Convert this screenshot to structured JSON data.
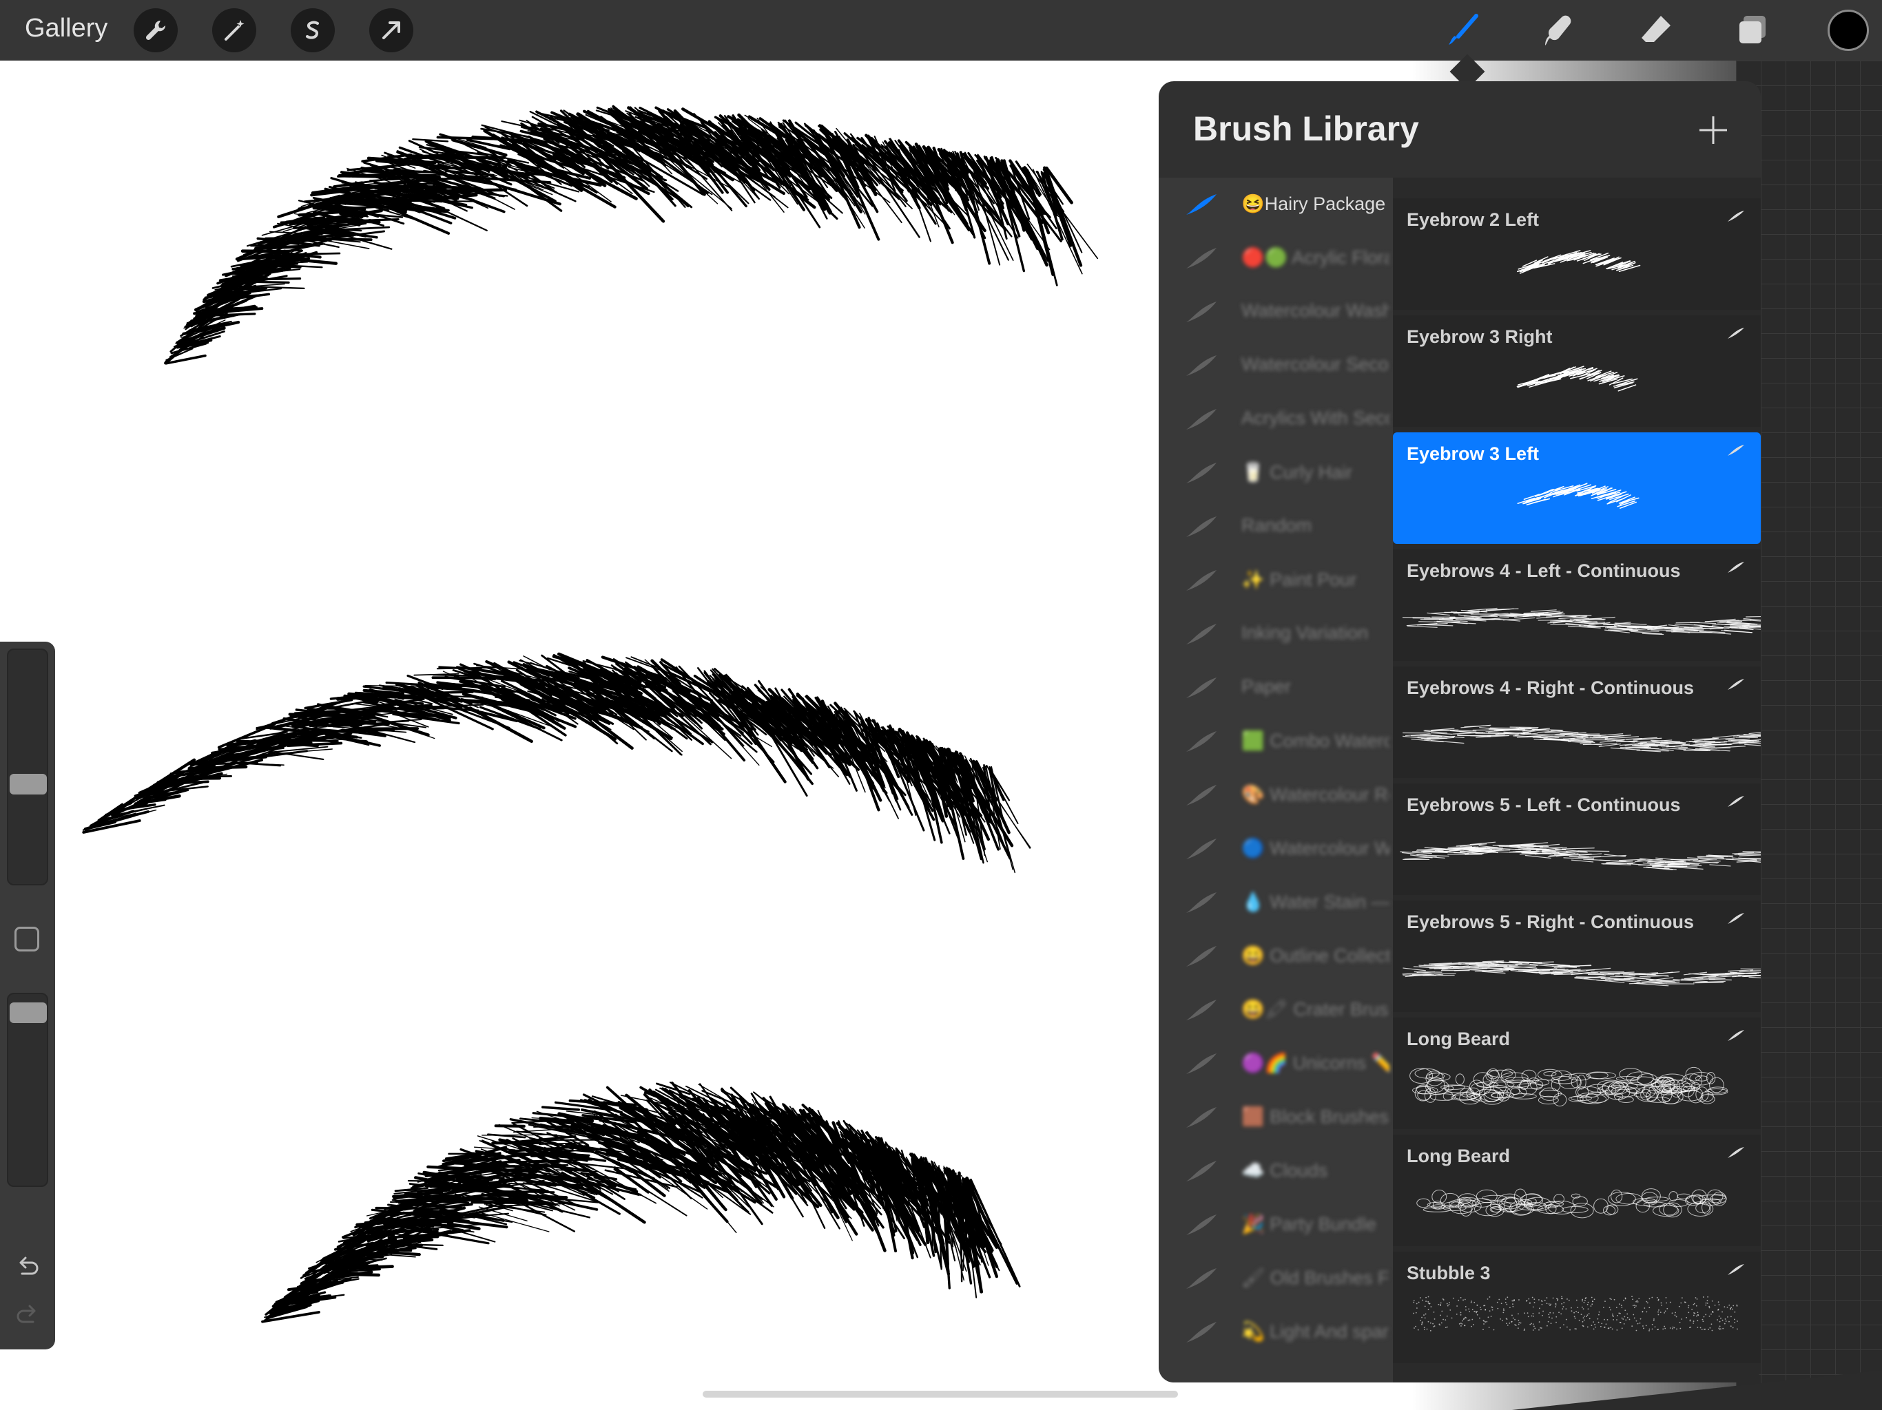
{
  "toolbar": {
    "gallery_label": "Gallery",
    "left_tools": [
      "wrench-icon",
      "magic-wand-icon",
      "selection-icon",
      "transform-arrow-icon"
    ],
    "right_tools": [
      "brush-icon",
      "smudge-icon",
      "eraser-icon",
      "layers-icon"
    ],
    "active_tool": "brush-icon",
    "active_color": "#000000",
    "accent_color": "#0a7aff"
  },
  "brush_library": {
    "title": "Brush Library",
    "brush_sets": [
      {
        "label": "😆Hairy Package",
        "active": true
      },
      {
        "label": "🔴🟢 Acrylic Floral P...",
        "active": false
      },
      {
        "label": "Watercolour Wash ...",
        "active": false
      },
      {
        "label": "Watercolour Seconda...",
        "active": false
      },
      {
        "label": "Acrylics With Seconda...",
        "active": false
      },
      {
        "label": "🥛 Curly Hair",
        "active": false
      },
      {
        "label": "Random",
        "active": false
      },
      {
        "label": "✨ Paint Pour",
        "active": false
      },
      {
        "label": "Inking Variation",
        "active": false
      },
      {
        "label": "Paper",
        "active": false
      },
      {
        "label": "🟩 Combo Watercolo...",
        "active": false
      },
      {
        "label": "🎨 Watercolour Reba...",
        "active": false
      },
      {
        "label": "🔵 Watercolour Water...",
        "active": false
      },
      {
        "label": "💧 Water Stain — W...",
        "active": false
      },
      {
        "label": "😀 Outline Collection",
        "active": false
      },
      {
        "label": "😀🖍 Crater Brushes...",
        "active": false
      },
      {
        "label": "🟣🌈 Unicorns ✏️ Let...",
        "active": false
      },
      {
        "label": "🟫 Block Brushes",
        "active": false
      },
      {
        "label": "☁️ Clouds",
        "active": false
      },
      {
        "label": "🎉 Party Bundle",
        "active": false
      },
      {
        "label": "🖌 Old Brushes For B...",
        "active": false
      },
      {
        "label": "💫 Light And spar...",
        "active": false
      }
    ],
    "brushes": [
      {
        "name": "Eyebrow 2 Left",
        "selected": false,
        "preview": "small-arc"
      },
      {
        "name": "Eyebrow 3 Right",
        "selected": false,
        "preview": "small-arc"
      },
      {
        "name": "Eyebrow 3 Left",
        "selected": true,
        "preview": "small-arc"
      },
      {
        "name": "Eyebrows 4  - Left  - Continuous",
        "selected": false,
        "preview": "wave"
      },
      {
        "name": "Eyebrows 4  - Right  - Continuous",
        "selected": false,
        "preview": "wave"
      },
      {
        "name": "Eyebrows 5  - Left  - Continuous",
        "selected": false,
        "preview": "wave"
      },
      {
        "name": "Eyebrows 5  - Right  - Continuous",
        "selected": false,
        "preview": "wave"
      },
      {
        "name": "Long Beard",
        "selected": false,
        "preview": "scribble"
      },
      {
        "name": "Long Beard",
        "selected": false,
        "preview": "scribble-thin"
      },
      {
        "name": "Stubble 3",
        "selected": false,
        "preview": "dots"
      }
    ]
  },
  "sidebar": {
    "size_slider_level": 0.42,
    "opacity_slider_level": 0.95
  }
}
